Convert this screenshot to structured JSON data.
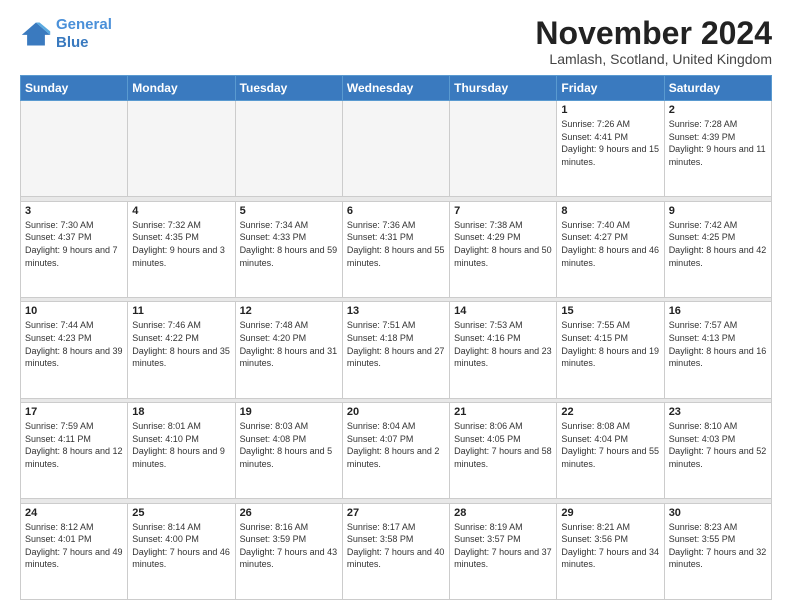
{
  "header": {
    "logo_line1": "General",
    "logo_line2": "Blue",
    "month_title": "November 2024",
    "location": "Lamlash, Scotland, United Kingdom"
  },
  "weekdays": [
    "Sunday",
    "Monday",
    "Tuesday",
    "Wednesday",
    "Thursday",
    "Friday",
    "Saturday"
  ],
  "weeks": [
    [
      {
        "day": "",
        "info": ""
      },
      {
        "day": "",
        "info": ""
      },
      {
        "day": "",
        "info": ""
      },
      {
        "day": "",
        "info": ""
      },
      {
        "day": "",
        "info": ""
      },
      {
        "day": "1",
        "info": "Sunrise: 7:26 AM\nSunset: 4:41 PM\nDaylight: 9 hours and 15 minutes."
      },
      {
        "day": "2",
        "info": "Sunrise: 7:28 AM\nSunset: 4:39 PM\nDaylight: 9 hours and 11 minutes."
      }
    ],
    [
      {
        "day": "3",
        "info": "Sunrise: 7:30 AM\nSunset: 4:37 PM\nDaylight: 9 hours and 7 minutes."
      },
      {
        "day": "4",
        "info": "Sunrise: 7:32 AM\nSunset: 4:35 PM\nDaylight: 9 hours and 3 minutes."
      },
      {
        "day": "5",
        "info": "Sunrise: 7:34 AM\nSunset: 4:33 PM\nDaylight: 8 hours and 59 minutes."
      },
      {
        "day": "6",
        "info": "Sunrise: 7:36 AM\nSunset: 4:31 PM\nDaylight: 8 hours and 55 minutes."
      },
      {
        "day": "7",
        "info": "Sunrise: 7:38 AM\nSunset: 4:29 PM\nDaylight: 8 hours and 50 minutes."
      },
      {
        "day": "8",
        "info": "Sunrise: 7:40 AM\nSunset: 4:27 PM\nDaylight: 8 hours and 46 minutes."
      },
      {
        "day": "9",
        "info": "Sunrise: 7:42 AM\nSunset: 4:25 PM\nDaylight: 8 hours and 42 minutes."
      }
    ],
    [
      {
        "day": "10",
        "info": "Sunrise: 7:44 AM\nSunset: 4:23 PM\nDaylight: 8 hours and 39 minutes."
      },
      {
        "day": "11",
        "info": "Sunrise: 7:46 AM\nSunset: 4:22 PM\nDaylight: 8 hours and 35 minutes."
      },
      {
        "day": "12",
        "info": "Sunrise: 7:48 AM\nSunset: 4:20 PM\nDaylight: 8 hours and 31 minutes."
      },
      {
        "day": "13",
        "info": "Sunrise: 7:51 AM\nSunset: 4:18 PM\nDaylight: 8 hours and 27 minutes."
      },
      {
        "day": "14",
        "info": "Sunrise: 7:53 AM\nSunset: 4:16 PM\nDaylight: 8 hours and 23 minutes."
      },
      {
        "day": "15",
        "info": "Sunrise: 7:55 AM\nSunset: 4:15 PM\nDaylight: 8 hours and 19 minutes."
      },
      {
        "day": "16",
        "info": "Sunrise: 7:57 AM\nSunset: 4:13 PM\nDaylight: 8 hours and 16 minutes."
      }
    ],
    [
      {
        "day": "17",
        "info": "Sunrise: 7:59 AM\nSunset: 4:11 PM\nDaylight: 8 hours and 12 minutes."
      },
      {
        "day": "18",
        "info": "Sunrise: 8:01 AM\nSunset: 4:10 PM\nDaylight: 8 hours and 9 minutes."
      },
      {
        "day": "19",
        "info": "Sunrise: 8:03 AM\nSunset: 4:08 PM\nDaylight: 8 hours and 5 minutes."
      },
      {
        "day": "20",
        "info": "Sunrise: 8:04 AM\nSunset: 4:07 PM\nDaylight: 8 hours and 2 minutes."
      },
      {
        "day": "21",
        "info": "Sunrise: 8:06 AM\nSunset: 4:05 PM\nDaylight: 7 hours and 58 minutes."
      },
      {
        "day": "22",
        "info": "Sunrise: 8:08 AM\nSunset: 4:04 PM\nDaylight: 7 hours and 55 minutes."
      },
      {
        "day": "23",
        "info": "Sunrise: 8:10 AM\nSunset: 4:03 PM\nDaylight: 7 hours and 52 minutes."
      }
    ],
    [
      {
        "day": "24",
        "info": "Sunrise: 8:12 AM\nSunset: 4:01 PM\nDaylight: 7 hours and 49 minutes."
      },
      {
        "day": "25",
        "info": "Sunrise: 8:14 AM\nSunset: 4:00 PM\nDaylight: 7 hours and 46 minutes."
      },
      {
        "day": "26",
        "info": "Sunrise: 8:16 AM\nSunset: 3:59 PM\nDaylight: 7 hours and 43 minutes."
      },
      {
        "day": "27",
        "info": "Sunrise: 8:17 AM\nSunset: 3:58 PM\nDaylight: 7 hours and 40 minutes."
      },
      {
        "day": "28",
        "info": "Sunrise: 8:19 AM\nSunset: 3:57 PM\nDaylight: 7 hours and 37 minutes."
      },
      {
        "day": "29",
        "info": "Sunrise: 8:21 AM\nSunset: 3:56 PM\nDaylight: 7 hours and 34 minutes."
      },
      {
        "day": "30",
        "info": "Sunrise: 8:23 AM\nSunset: 3:55 PM\nDaylight: 7 hours and 32 minutes."
      }
    ]
  ]
}
